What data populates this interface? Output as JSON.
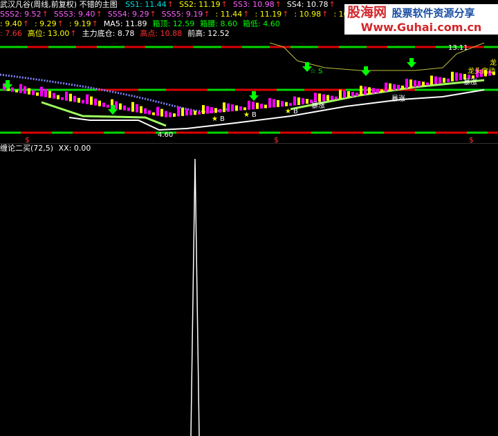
{
  "header": {
    "row1": {
      "title": "武汉凡谷(周线,前复权) 不错的主图",
      "items": [
        {
          "label": "SS1",
          "value": "11.44",
          "arrow": "↑",
          "color": "#00e0e0"
        },
        {
          "label": "SS2",
          "value": "11.19",
          "arrow": "↑",
          "color": "#ffff00"
        },
        {
          "label": "SS3",
          "value": "10.98",
          "arrow": "↑",
          "color": "#ff60ff"
        },
        {
          "label": "SS4",
          "value": "10.78",
          "arrow": "↑",
          "color": "#ffffff"
        }
      ]
    },
    "row2": {
      "items": [
        {
          "label": "SSS2",
          "value": "9.52",
          "arrow": "↑",
          "color": "#ff60ff"
        },
        {
          "label": "SSS3",
          "value": "9.40",
          "arrow": "↑",
          "color": "#ff60ff"
        },
        {
          "label": "SSS4",
          "value": "9.29",
          "arrow": "↑",
          "color": "#ff60ff"
        },
        {
          "label": "SSS5",
          "value": "9.19",
          "arrow": "↑",
          "color": "#ff60ff"
        },
        {
          "label": "",
          "value": "11.44",
          "arrow": "↑",
          "color": "#ffff00"
        },
        {
          "label": "",
          "value": "11.19",
          "arrow": "↑",
          "color": "#ffff00"
        },
        {
          "label": "",
          "value": "10.98",
          "arrow": "↑",
          "color": "#ffff00"
        },
        {
          "label": "",
          "value": "10",
          "arrow": "",
          "color": "#ffff00"
        }
      ]
    },
    "row3": {
      "items": [
        {
          "label": "",
          "value": "9.40",
          "arrow": "↑",
          "color": "#ffff00"
        },
        {
          "label": "",
          "value": "9.29",
          "arrow": "↑",
          "color": "#ffff00"
        },
        {
          "label": "",
          "value": "9.19",
          "arrow": "↑",
          "color": "#ffff00"
        },
        {
          "label": "MA5",
          "value": "11.89",
          "arrow": "",
          "color": "#ffffff"
        },
        {
          "label": "箱顶",
          "value": "12.59",
          "arrow": "",
          "color": "#00ff00"
        },
        {
          "label": "箱腰",
          "value": "8.60",
          "arrow": "",
          "color": "#00ff00"
        },
        {
          "label": "箱低",
          "value": "4.60",
          "arrow": "",
          "color": "#00ff00"
        }
      ]
    },
    "row4": {
      "items": [
        {
          "label": "",
          "value": "7.66",
          "arrow": "",
          "color": "#ff3030"
        },
        {
          "label": "高位",
          "value": "13.00",
          "arrow": "↑",
          "color": "#ffff00"
        },
        {
          "label": "主力底仓",
          "value": "8.78",
          "arrow": "",
          "color": "#ffffff"
        },
        {
          "label": "高点",
          "value": "10.88",
          "arrow": "",
          "color": "#ff3030"
        },
        {
          "label": "前高",
          "value": "12.52",
          "arrow": "",
          "color": "#ffffff"
        }
      ]
    }
  },
  "main_chart": {
    "labels": {
      "low_price": "4.60",
      "high_price": "13.11",
      "sell_signal": "S",
      "buy_signal": "B",
      "surge": "暴涨",
      "dragon_start": "龙头启动",
      "dragon_char": "龙",
      "dollar": "$"
    },
    "colors": {
      "green_band": "#00d800",
      "red_band": "#e00000",
      "candle_up": "#ff00ff",
      "candle_down": "#ffff00",
      "support_line": "#ffffff",
      "signal_arrow": "#00ff00"
    }
  },
  "sub_chart": {
    "title": "缠论二买(72,5)",
    "xx_label": "XX",
    "xx_value": "0.00"
  },
  "watermark": {
    "brand": "股海网",
    "tagline": "股票软件资源分享",
    "url": "Www.Guhai.com.cn"
  }
}
